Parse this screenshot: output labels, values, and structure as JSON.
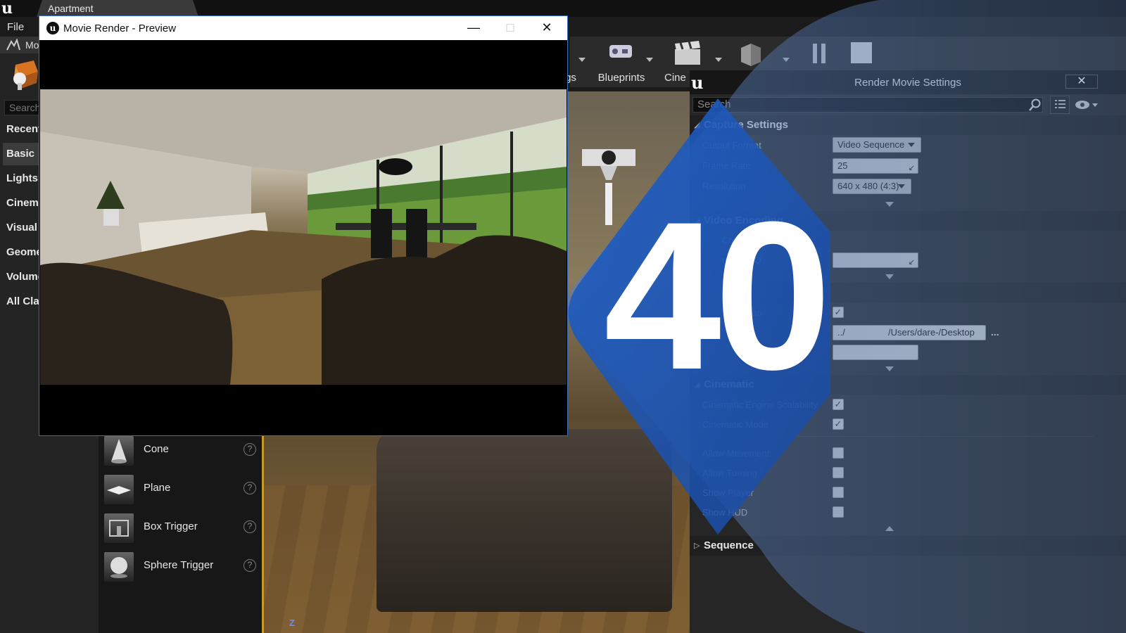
{
  "app": {
    "project_tab": "Apartment",
    "menu": {
      "file": "File"
    },
    "modes_tab": "Mo"
  },
  "left_panel": {
    "search_placeholder": "Search",
    "categories": [
      "Recent",
      "Basic",
      "Lights",
      "Cinema",
      "Visual",
      "Geome",
      "Volume",
      "All Clas"
    ],
    "active_category": "Basic",
    "place_items": [
      {
        "label": "Cone",
        "help": "?"
      },
      {
        "label": "Plane",
        "help": "?"
      },
      {
        "label": "Box Trigger",
        "help": "?"
      },
      {
        "label": "Sphere Trigger",
        "help": "?"
      }
    ]
  },
  "toolbar": {
    "partial_label": "gs",
    "blueprints_label": "Blueprints",
    "cinematics_label": "Cine"
  },
  "preview_window": {
    "title": "Movie Render - Preview",
    "minimize": "—",
    "maximize": "□",
    "close": "✕"
  },
  "render_settings": {
    "title": "Render Movie Settings",
    "close": "✕",
    "search_placeholder": "Search",
    "sections": {
      "capture": {
        "title": "Capture Settings",
        "output_format_label": "Output Format",
        "output_format_value": "Video Sequence",
        "frame_rate_label": "Frame Rate",
        "frame_rate_value": "25",
        "resolution_label": "Resolution",
        "resolution_value": "640 x 480 (4:3)"
      },
      "video_encoding": {
        "title": "Video Encoding",
        "compression_label": "Compression",
        "compression_quality_label": "ression Q"
      },
      "general": {
        "title": "eral",
        "start_capture_label": "Start Cap",
        "directory_label": "ecto",
        "directory_path": "/Users/dare-/Desktop",
        "directory_prefix": "../",
        "browse": "...",
        "format_label": "Forma"
      },
      "cinematic": {
        "title": "Cinematic",
        "engine_scalability_label": "Cinematic Engine Scalability",
        "engine_scalability_checked": true,
        "mode_label": "Cinematic Mode",
        "mode_checked": true,
        "allow_movement_label": "Allow Movement",
        "allow_movement_checked": false,
        "allow_turning_label": "Allow Turning",
        "allow_turning_checked": false,
        "show_player_label": "Show Player",
        "show_player_checked": false,
        "show_hud_label": "Show HUD",
        "show_hud_checked": false
      },
      "sequence": {
        "title": "Sequence"
      }
    }
  },
  "overlay": {
    "episode_number": "40",
    "color": "#1e4fa8"
  },
  "viewport": {
    "axis_label": "Z"
  }
}
